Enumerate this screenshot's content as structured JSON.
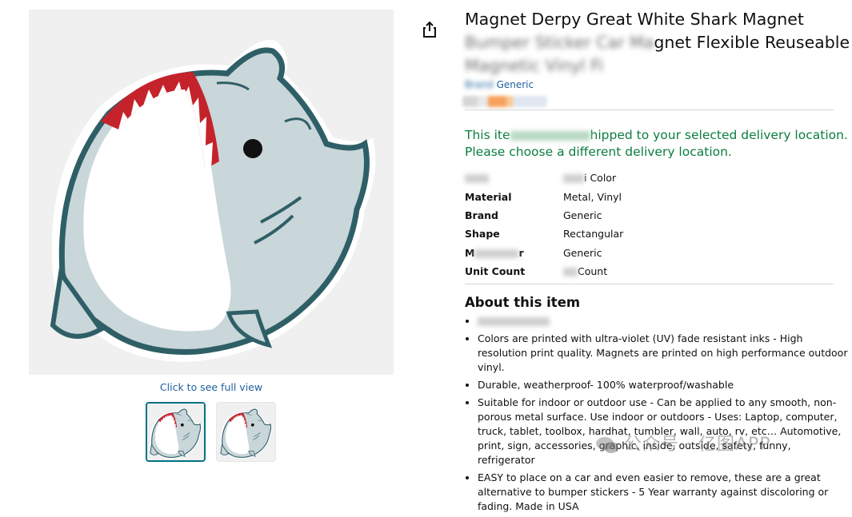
{
  "product": {
    "title_line1": "Magnet Derpy Great White Shark Magnet",
    "title_line2_blurred": "Bumper Sticker Car Ma",
    "title_line2_visible": "gnet Flexible Reuseable",
    "title_line3_blurred": "Magnetic Vinyl Fi",
    "brand_prefix_blurred": "Brand",
    "brand_name": "Generic"
  },
  "gallery": {
    "full_view_label": "Click to see full view"
  },
  "delivery": {
    "line1_start": "This ite",
    "line1_end": "hipped to your selected delivery location.",
    "line2": "Please choose a different delivery location."
  },
  "specs": [
    {
      "key": "",
      "value_suffix": "i Color"
    },
    {
      "key": "Material",
      "value": "Metal, Vinyl"
    },
    {
      "key": "Brand",
      "value": "Generic"
    },
    {
      "key": "Shape",
      "value": "Rectangular"
    },
    {
      "key_start": "M",
      "key_end": "r",
      "value": "Generic"
    },
    {
      "key": "Unit Count",
      "value_suffix": "Count"
    }
  ],
  "about": {
    "heading": "About this item",
    "bullets": [
      "Colors are printed with ultra-violet (UV) fade resistant inks - High resolution print quality. Magnets are printed on high performance outdoor vinyl.",
      "Durable, weatherproof- 100% waterproof/washable",
      "Suitable for indoor or outdoor use - Can be applied to any smooth, non-porous metal surface. Use indoor or outdoors - Uses: Laptop, computer, truck, tablet, toolbox, hardhat, tumbler, wall, auto, rv, etc… Automotive, print, sign, accessories, graphic, inside, outside, safety, funny, refrigerator",
      "EASY to place on a car and even easier to remove, these are a great alternative to bumper stickers - 5 Year warranty against discoloring or fading. Made in USA"
    ]
  },
  "watermark": {
    "text": "公众号 · 亿图APP"
  },
  "colors": {
    "link": "#2162a1",
    "delivery_green": "#0b7d3e",
    "shark_outline": "#2f5f66",
    "shark_body": "#c9d6da",
    "shark_mouth": "#c4232b"
  },
  "icons": {
    "share": "share-icon",
    "watermark": "wechat-icon"
  }
}
